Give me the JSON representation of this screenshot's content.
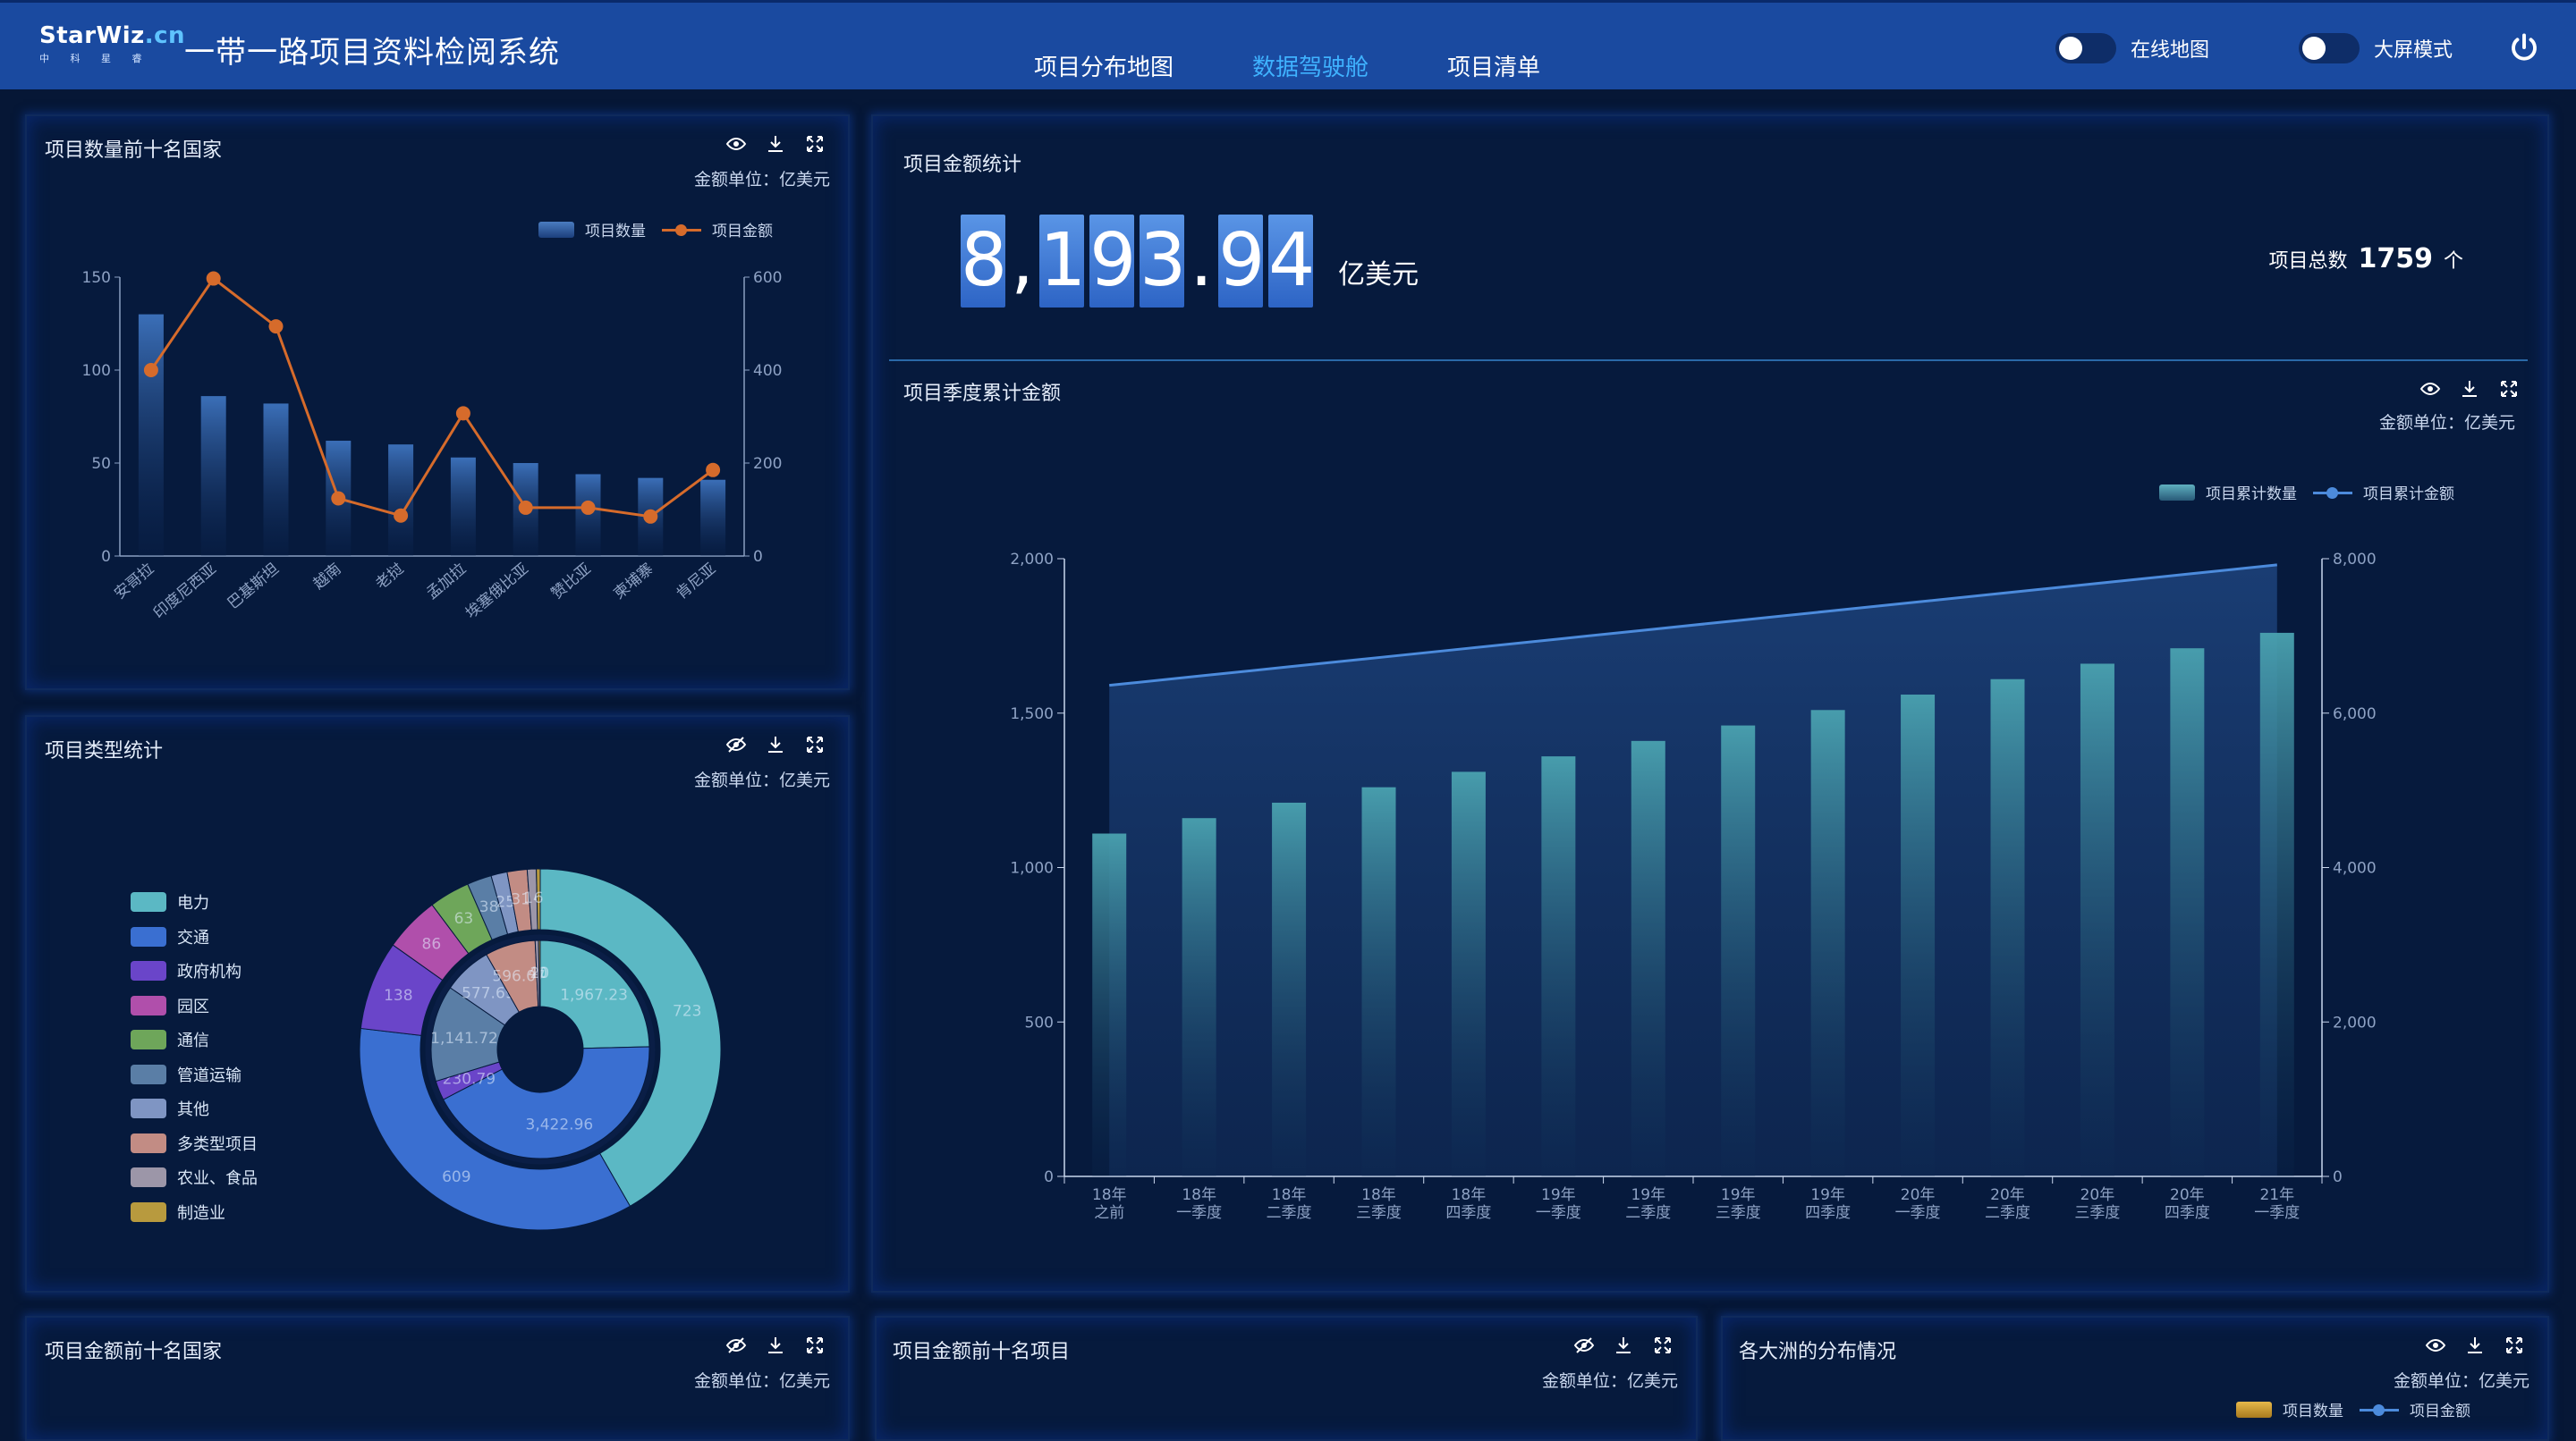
{
  "header": {
    "logo_main": "StarWiz",
    "logo_suffix": ".cn",
    "logo_sub": "中 科 星 睿",
    "title": "一带一路项目资料检阅系统",
    "nav": [
      "项目分布地图",
      "数据驾驶舱",
      "项目清单"
    ],
    "active_nav": "数据驾驶舱",
    "toggles": [
      {
        "label": "在线地图",
        "on": false
      },
      {
        "label": "大屏模式",
        "on": false
      }
    ]
  },
  "unit_label": "金额单位：亿美元",
  "panels": {
    "top_countries": {
      "title": "项目数量前十名国家",
      "legend_bar": "项目数量",
      "legend_line": "项目金额"
    },
    "project_types": {
      "title": "项目类型统计",
      "legend": [
        {
          "name": "电力",
          "color": "#5bb8c4"
        },
        {
          "name": "交通",
          "color": "#3a6fd1"
        },
        {
          "name": "政府机构",
          "color": "#6a45c9"
        },
        {
          "name": "园区",
          "color": "#b04fab"
        },
        {
          "name": "通信",
          "color": "#6ea65a"
        },
        {
          "name": "管道运输",
          "color": "#5a7ea6"
        },
        {
          "name": "其他",
          "color": "#7f95c3"
        },
        {
          "name": "多类型项目",
          "color": "#c28c84"
        },
        {
          "name": "农业、食品",
          "color": "#9c96a8"
        },
        {
          "name": "制造业",
          "color": "#b89a3e"
        }
      ]
    },
    "amount_stats": {
      "title": "项目金额统计",
      "total_amount": "8,193.94",
      "amount_unit": "亿美元",
      "count_label": "项目总数",
      "count_value": "1759",
      "count_unit": "个"
    },
    "quarterly": {
      "title": "项目季度累计金额",
      "legend_bar": "项目累计数量",
      "legend_line": "项目累计金额"
    },
    "bottom_left": {
      "title": "项目金额前十名国家"
    },
    "bottom_mid": {
      "title": "项目金额前十名项目"
    },
    "bottom_right": {
      "title": "各大洲的分布情况",
      "legend_bar": "项目数量",
      "legend_line": "项目金额"
    }
  },
  "chart_data": [
    {
      "type": "bar",
      "title": "项目数量前十名国家",
      "categories": [
        "安哥拉",
        "印度尼西亚",
        "巴基斯坦",
        "越南",
        "老挝",
        "孟加拉",
        "埃塞俄比亚",
        "赞比亚",
        "柬埔寨",
        "肯尼亚"
      ],
      "series": [
        {
          "name": "项目数量",
          "type": "bar",
          "axis": "left",
          "values": [
            130,
            86,
            82,
            62,
            60,
            53,
            50,
            44,
            42,
            41
          ]
        },
        {
          "name": "项目金额",
          "type": "line",
          "axis": "right",
          "values": [
            400,
            597,
            494,
            124,
            87,
            307,
            104,
            104,
            85,
            185
          ]
        }
      ],
      "y_left": {
        "ticks": [
          "0",
          "50",
          "100",
          "150"
        ],
        "lim": [
          0,
          150
        ]
      },
      "y_right": {
        "ticks": [
          "0",
          "200",
          "400",
          "600"
        ],
        "lim": [
          0,
          600
        ]
      }
    },
    {
      "type": "pie",
      "title": "项目类型统计",
      "inner_ring": [
        {
          "name": "电力",
          "value": 1967.23
        },
        {
          "name": "交通",
          "value": 3422.96
        },
        {
          "name": "政府机构",
          "value": 230.79
        },
        {
          "name": "管道运输",
          "value": 1141.72
        },
        {
          "name": "其他",
          "value": 577.69
        },
        {
          "name": "多类型项目",
          "value": 596.07
        },
        {
          "name": "农业、食品",
          "value": 40
        },
        {
          "name": "制造业",
          "value": 20
        }
      ],
      "outer_ring": [
        {
          "name": "电力",
          "value": 723
        },
        {
          "name": "交通",
          "value": 609
        },
        {
          "name": "政府机构",
          "value": 138
        },
        {
          "name": "园区",
          "value": 86
        },
        {
          "name": "通信",
          "value": 63
        },
        {
          "name": "管道运输",
          "value": 38
        },
        {
          "name": "其他",
          "value": 25
        },
        {
          "name": "多类型项目",
          "value": 31
        },
        {
          "name": "农业、食品",
          "value": 14
        },
        {
          "name": "制造业",
          "value": 6
        }
      ]
    },
    {
      "type": "bar",
      "title": "项目季度累计金额",
      "categories": [
        [
          "18年",
          "之前"
        ],
        [
          "18年",
          "一季度"
        ],
        [
          "18年",
          "二季度"
        ],
        [
          "18年",
          "三季度"
        ],
        [
          "18年",
          "四季度"
        ],
        [
          "19年",
          "一季度"
        ],
        [
          "19年",
          "二季度"
        ],
        [
          "19年",
          "三季度"
        ],
        [
          "19年",
          "四季度"
        ],
        [
          "20年",
          "一季度"
        ],
        [
          "20年",
          "二季度"
        ],
        [
          "20年",
          "三季度"
        ],
        [
          "20年",
          "四季度"
        ],
        [
          "21年",
          "一季度"
        ]
      ],
      "series": [
        {
          "name": "项目累计数量",
          "type": "bar",
          "axis": "left",
          "values": [
            1110,
            1160,
            1210,
            1260,
            1310,
            1360,
            1410,
            1460,
            1510,
            1560,
            1610,
            1660,
            1710,
            1760
          ]
        },
        {
          "name": "项目累计金额",
          "type": "area",
          "axis": "right",
          "values": [
            6360,
            6480,
            6600,
            6720,
            6840,
            6960,
            7080,
            7200,
            7320,
            7440,
            7560,
            7680,
            7800,
            7920
          ]
        }
      ],
      "y_left": {
        "ticks": [
          "0",
          "500",
          "1,000",
          "1,500",
          "2,000"
        ],
        "lim": [
          0,
          2000
        ]
      },
      "y_right": {
        "ticks": [
          "0",
          "2,000",
          "4,000",
          "6,000",
          "8,000"
        ],
        "lim": [
          0,
          8000
        ]
      }
    }
  ]
}
